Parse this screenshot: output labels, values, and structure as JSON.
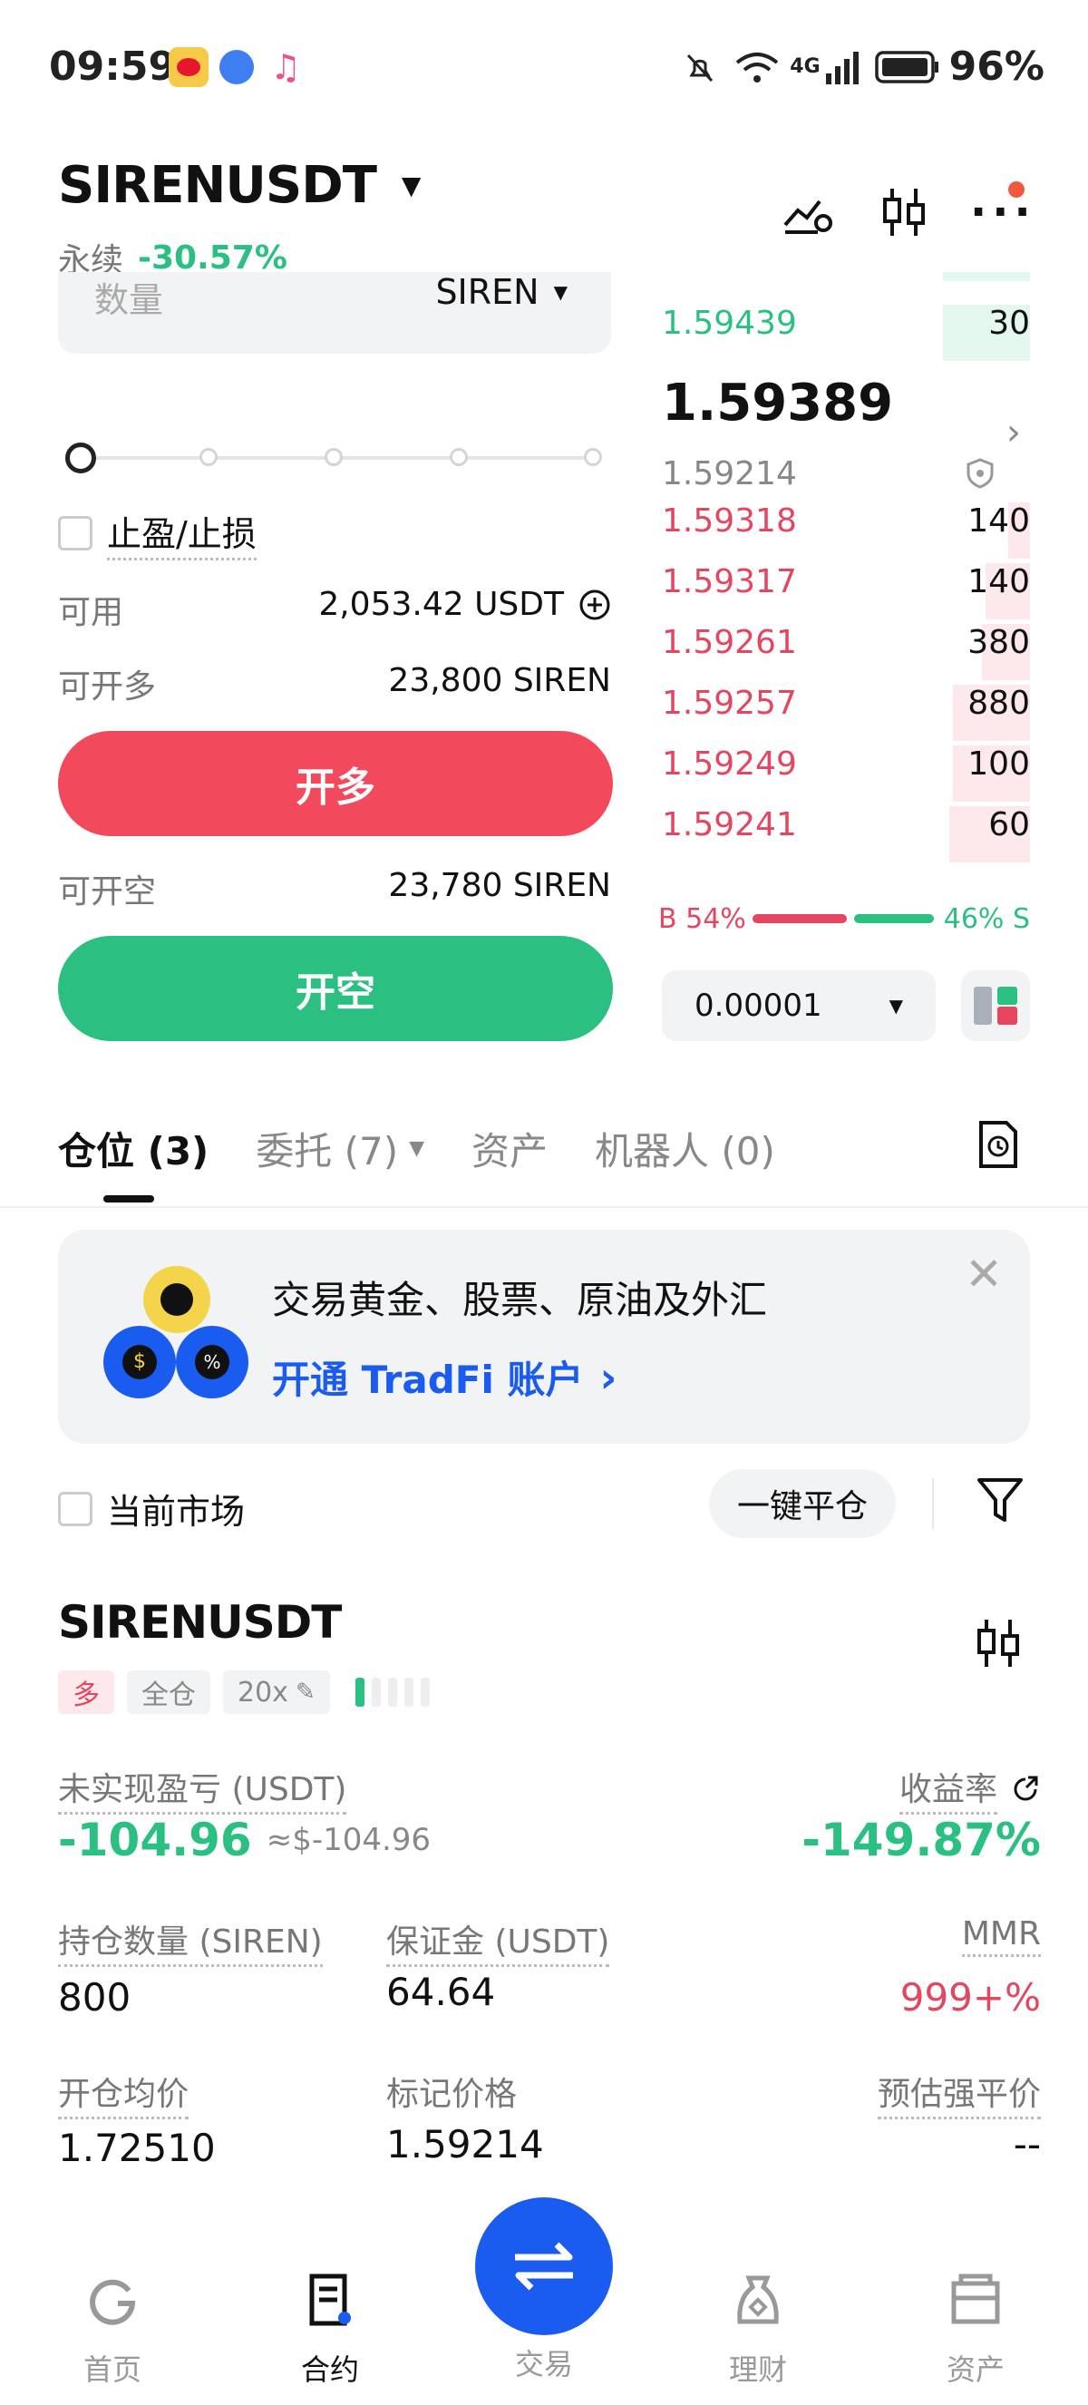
{
  "status_bar": {
    "time": "09:59",
    "network": "4G",
    "battery": "96%"
  },
  "header": {
    "pair": "SIRENUSDT",
    "type": "永续",
    "change": "-30.57%"
  },
  "order_form": {
    "quantity_placeholder": "数量",
    "quantity_unit": "SIREN",
    "tp_sl_label": "止盈/止损",
    "available_label": "可用",
    "available_value": "2,053.42 USDT",
    "can_long_label": "可开多",
    "can_long_value": "23,800 SIREN",
    "long_button": "开多",
    "can_short_label": "可开空",
    "can_short_value": "23,780 SIREN",
    "short_button": "开空"
  },
  "order_book": {
    "asks": [
      {
        "price": "1.59439",
        "qty": "30"
      }
    ],
    "last_price": "1.59389",
    "mark_price": "1.59214",
    "bids": [
      {
        "price": "1.59318",
        "qty": "140",
        "depth": 0.06
      },
      {
        "price": "1.59317",
        "qty": "140",
        "depth": 0.12
      },
      {
        "price": "1.59261",
        "qty": "380",
        "depth": 0.13
      },
      {
        "price": "1.59257",
        "qty": "880",
        "depth": 0.21
      },
      {
        "price": "1.59249",
        "qty": "100",
        "depth": 0.21
      },
      {
        "price": "1.59241",
        "qty": "60",
        "depth": 0.22
      }
    ],
    "buy_ratio_label": "B 54%",
    "sell_ratio_label": "46% S",
    "buy_ratio": 0.54,
    "precision": "0.00001"
  },
  "tabs": {
    "positions": "仓位 (3)",
    "orders": "委托 (7)",
    "assets": "资产",
    "bots": "机器人 (0)"
  },
  "banner": {
    "title": "交易黄金、股票、原油及外汇",
    "link": "开通 TradFi 账户"
  },
  "filter": {
    "current_market": "当前市场",
    "close_all": "一键平仓"
  },
  "position": {
    "symbol": "SIRENUSDT",
    "side": "多",
    "margin_mode": "全仓",
    "leverage": "20x",
    "unrealized_label": "未实现盈亏 (USDT)",
    "unrealized_value": "-104.96",
    "unrealized_usd": "≈$-104.96",
    "roi_label": "收益率",
    "roi_value": "-149.87%",
    "size_label": "持仓数量 (SIREN)",
    "size_value": "800",
    "margin_label": "保证金 (USDT)",
    "margin_value": "64.64",
    "mmr_label": "MMR",
    "mmr_value": "999+%",
    "entry_label": "开仓均价",
    "entry_value": "1.72510",
    "mark_label": "标记价格",
    "mark_value": "1.59214",
    "liq_label": "预估强平价",
    "liq_value": "--"
  },
  "bottom_nav": {
    "home": "首页",
    "futures": "合约",
    "trade": "交易",
    "earn": "理财",
    "assets": "资产"
  },
  "colors": {
    "long": "#f2495d",
    "short": "#2bbf82",
    "accent": "#1a5bf0"
  }
}
